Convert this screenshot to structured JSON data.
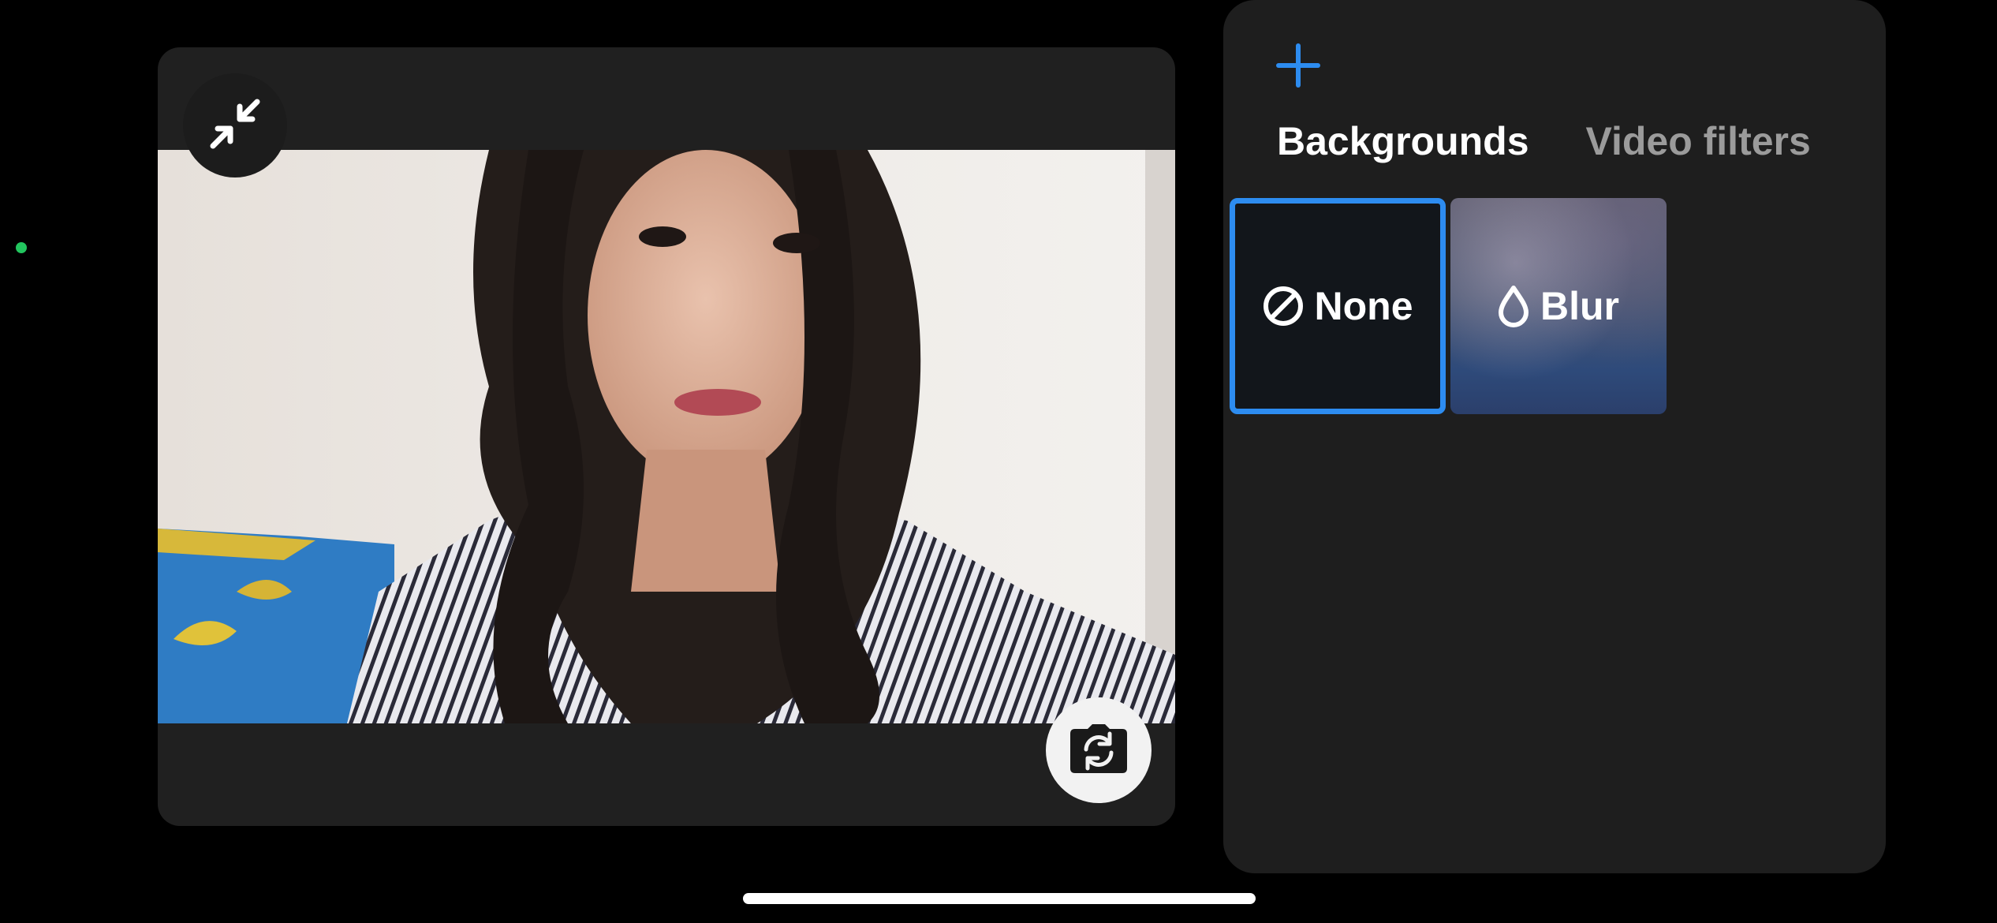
{
  "status": {
    "dot_color": "#22c55e"
  },
  "preview": {
    "collapse_icon": "collapse-arrows-icon",
    "switch_camera_icon": "camera-switch-icon"
  },
  "effects": {
    "add_icon": "plus-icon",
    "accent_color": "#2d8cf0",
    "tabs": [
      {
        "label": "Backgrounds",
        "active": true
      },
      {
        "label": "Video filters",
        "active": false
      }
    ],
    "options": [
      {
        "label": "None",
        "icon": "prohibited-icon",
        "selected": true
      },
      {
        "label": "Blur",
        "icon": "droplet-icon",
        "selected": false
      }
    ]
  },
  "home_indicator": {
    "color": "#ffffff"
  }
}
